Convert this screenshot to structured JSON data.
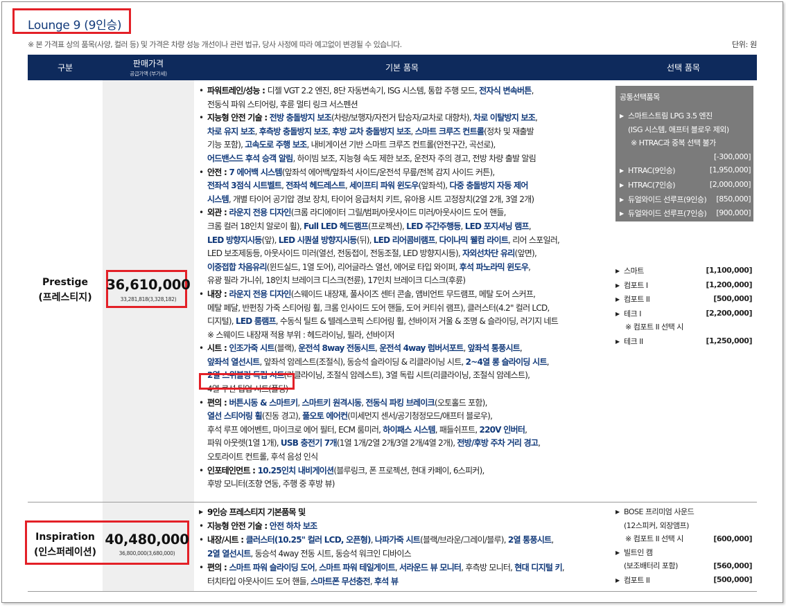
{
  "title": "Lounge 9 (9인승)",
  "disclaimer": "※ 본 가격표 상의 품목(사양, 컬러 등) 및 가격은 차량 성능 개선이나 관련 법규, 당사 사정에 따라 예고없이 변경될 수 있습니다.",
  "unit": "단위: 원",
  "header": {
    "col_trim": "구분",
    "col_price": "판매가격",
    "col_price_sub": "공급가액 (부가세)",
    "col_basic": "기본 품목",
    "col_option": "선택 품목"
  },
  "prestige": {
    "name": "Prestige",
    "name_kr": "(프레스티지)",
    "price": "36,610,000",
    "price_sub": "33,281,818(3,328,182)",
    "features": [
      {
        "head": "파워트레인/성능 : ",
        "html": "디젤 VGT 2.2 엔진, 8단 자동변속기, ISG 시스템, 통합 주행 모드, <b class=\"hl\">전자식 변속버튼</b>,<br>전동식 파워 스티어링, 후륜 멀티 링크 서스펜션"
      },
      {
        "head": "지능형 안전 기술 : ",
        "html": "<b class=\"hl\">전방 충돌방지 보조</b>(차량/보행자/자전거 탑승자/교차로 대향차), <b class=\"hl\">차로 이탈방지 보조</b>,<br><b class=\"hl\">차로 유지 보조</b>, <b class=\"hl\">후측방 충돌방지 보조</b>, <b class=\"hl\">후방 교차 충돌방지 보조</b>, <b class=\"hl\">스마트 크루즈 컨트롤</b>(정차 및 재출발<br>기능 포함), <b class=\"hl\">고속도로 주행 보조</b>, 내비게이션 기반 스마트 크루즈 컨트롤(안전구간, 곡선로),<br><b class=\"hl\">어드밴스드 후석 승객 알림</b>, 하이빔 보조, 지능형 속도 제한 보조, 운전자 주의 경고, 전방 차량 출발 알림"
      },
      {
        "head": "안전 : ",
        "html": "<b class=\"hl\">7 에어백 시스템</b>(앞좌석 에어백/앞좌석 사이드/운전석 무릎/전복 감지 사이드 커튼),<br><b class=\"hl\">전좌석 3점식 시트벨트</b>, <b class=\"hl\">전좌석 헤드레스트</b>, <b class=\"hl\">세이프티 파워 윈도우</b>(앞좌석), <b class=\"hl\">다중 충돌방지 자동 제어<br>시스템</b>, 개별 타이어 공기압 경보 장치, 타이어 응급처치 키트, 유아용 시트 고정장치(2열 2개, 3열 2개)"
      },
      {
        "head": "외관 : ",
        "html": "<b class=\"hl\">라운지 전용 디자인</b>(크롬 라디에이터 그릴/범퍼/아웃사이드 미러/아웃사이드 도어 핸들,<br>크롬 컬러 18인치 알로이 휠), <b class=\"hl\">Full LED 헤드램프</b>(프로젝션), <b class=\"hl\">LED 주간주행등</b>, <b class=\"hl\">LED 포지셔닝 램프</b>,<br><b class=\"hl\">LED 방향지시등</b>(앞), <b class=\"hl\">LED 시퀀셜 방향지시등</b>(뒤), <b class=\"hl\">LED 리어콤비램프</b>, <b class=\"hl\">다이나믹 웰컴 라이트</b>, 리어 스포일러,<br>LED 보조제동등, 아웃사이드 미러(열선, 전동접이, 전동조절, LED 방향지시등), <b class=\"hl\">자외선차단 유리</b>(앞면),<br><b class=\"hl\">이중접합 차음유리</b>(윈드실드, 1열 도어), 리어글라스 열선, 에어로 타입 와이퍼, <b class=\"hl\">후석 파노라믹 윈도우</b>,<br>유광 필라 가니쉬, 18인치 브레이크 디스크(전륜), 17인치 브레이크 디스크(후륜)"
      },
      {
        "head": "내장 : ",
        "html": "<b class=\"hl\">라운지 전용 디자인</b>(스웨이드 내장재, 풀사이즈 센터 콘솔, 앰비언트 무드램프, 메탈 도어 스커프,<br>메탈 페달, 반펀칭 가죽 스티어링 휠, 크롬 인사이드 도어 핸들, 도어 커티쉬 램프), 클러스터(4.2\" 컬러 LCD,<br>디지털), <b class=\"hl\">LED 룸램프</b>, 수동식 틸트 &amp; 텔레스코픽 스티어링 휠, 선바이저 거울 &amp; 조명 &amp; 슬라이딩, 러기지 네트<br>※ 스웨이드 내장재 적용 부위 : 헤드라이닝, 필라, 선바이저"
      },
      {
        "head": "시트 : ",
        "html": "<b class=\"hl\">인조가죽 시트</b>(블랙), <b class=\"hl\">운전석 8way 전동시트</b>, <b class=\"hl\">운전석 4way 럼버서포트</b>, <b class=\"hl\">앞좌석 통풍시트</b>,<br><b class=\"hl\">앞좌석 열선시트</b>, 앞좌석 암레스트(조절식), 동승석 슬라이딩 &amp; 리클라이닝 시트, <b class=\"hl\">2~4열 롱 슬라이딩 시트</b>,<br><b class=\"hl\">2열 스위블링 독립 시트</b>(리클라이닝, 조절식 암레스트), 3열 독립 시트(리클라이닝, 조절식 암레스트),<br>4열 쿠션 팁업 시트(폴딩)"
      },
      {
        "head": "편의 : ",
        "html": "<b class=\"hl\">버튼시동 &amp; 스마트키</b>, <b class=\"hl\">스마트키 원격시동</b>, <b class=\"hl\">전동식 파킹 브레이크</b>(오토홀드 포함),<br><b class=\"hl\">열선 스티어링 휠</b>(진동 경고), <b class=\"hl\">풀오토 에어컨</b>(미세먼지 센서/공기청정모드/애프터 블로우),<br>후석 루프 에어벤트, 마이크로 에어 필터, ECM 룸미러, <b class=\"hl\">하이패스 시스템</b>, 패들쉬프트, <b class=\"hl\">220V 인버터</b>,<br>파워 아웃렛(1열 1개), <b class=\"hl\">USB 충전기 7개</b>(1열 1개/2열 2개/3열 2개/4열 2개), <b class=\"hl\">전방/후방 주차 거리 경고</b>,<br>오토라이트 컨트롤, 후석 음성 인식"
      },
      {
        "head": "인포테인먼트 : ",
        "html": "<b class=\"hl\">10.25인치 내비게이션</b>(블루링크, 폰 프로젝션, 현대 카페이, 6스피커),<br>후방 모니터(조향 연동, 주행 중 후방 뷰)"
      }
    ],
    "common_options_title": "공통선택품목",
    "common_options": [
      {
        "name": "스마트스트림 LPG 3.5 엔진",
        "sub1": "(ISG 시스템, 애프터 블로우 제외)",
        "sub2": "※ HTRAC과 중복 선택 불가",
        "price": "[-300,000]"
      },
      {
        "name": "HTRAC(9인승)",
        "price": "[1,950,000]"
      },
      {
        "name": "HTRAC(7인승)",
        "price": "[2,000,000]"
      },
      {
        "name": "듀얼와이드 선루프(9인승)",
        "price": "[850,000]"
      },
      {
        "name": "듀얼와이드 선루프(7인승)",
        "price": "[900,000]"
      }
    ],
    "options": [
      {
        "name": "스마트",
        "price": "[1,100,000]"
      },
      {
        "name": "컴포트 I",
        "price": "[1,200,000]"
      },
      {
        "name": "컴포트 II",
        "price": "[500,000]"
      },
      {
        "name": "테크 I",
        "price": "[2,200,000]",
        "note": "※ 컴포트 II 선택 시"
      },
      {
        "name": "테크 II",
        "price": "[1,250,000]"
      }
    ]
  },
  "inspiration": {
    "name": "Inspiration",
    "name_kr": "(인스퍼레이션)",
    "price": "40,480,000",
    "price_sub": "36,800,000(3,680,000)",
    "features": [
      {
        "head": "9인승 프레스티지 기본품목 및",
        "html": "",
        "arrow": true
      },
      {
        "head": "지능형 안전 기술 : ",
        "html": "<b class=\"hl\">안전 하차 보조</b>"
      },
      {
        "head": "내장/시트 : ",
        "html": "<b class=\"hl\">클러스터(10.25\" 컬러 LCD, 오픈형)</b>, <b class=\"hl\">나파가죽 시트</b>(블랙/브라운/그레이/블루), <b class=\"hl\">2열 통풍시트</b>,<br><b class=\"hl\">2열 열선시트</b>, 동승석 4way 전동 시트, 동승석 워크인 디바이스"
      },
      {
        "head": "편의 : ",
        "html": "<b class=\"hl\">스마트 파워 슬라이딩 도어</b>, <b class=\"hl\">스마트 파워 테일게이트</b>, <b class=\"hl\">서라운드 뷰 모니터</b>, 후측방 모니터, <b class=\"hl\">현대 디지털 키</b>,<br>터치타입 아웃사이드 도어 핸들, <b class=\"hl\">스마트폰 무선충전</b>, <b class=\"hl\">후석 뷰</b>"
      }
    ],
    "options": [
      {
        "name": "BOSE 프리미엄 사운드",
        "sub": "(12스피커, 외장앰프)",
        "note": "※ 컴포트 II 선택 시",
        "price": "[600,000]"
      },
      {
        "name": "빌트인 캠",
        "sub": "(보조배터리 포함)",
        "price": "[560,000]"
      },
      {
        "name": "컴포트 II",
        "price": "[500,000]"
      }
    ]
  }
}
